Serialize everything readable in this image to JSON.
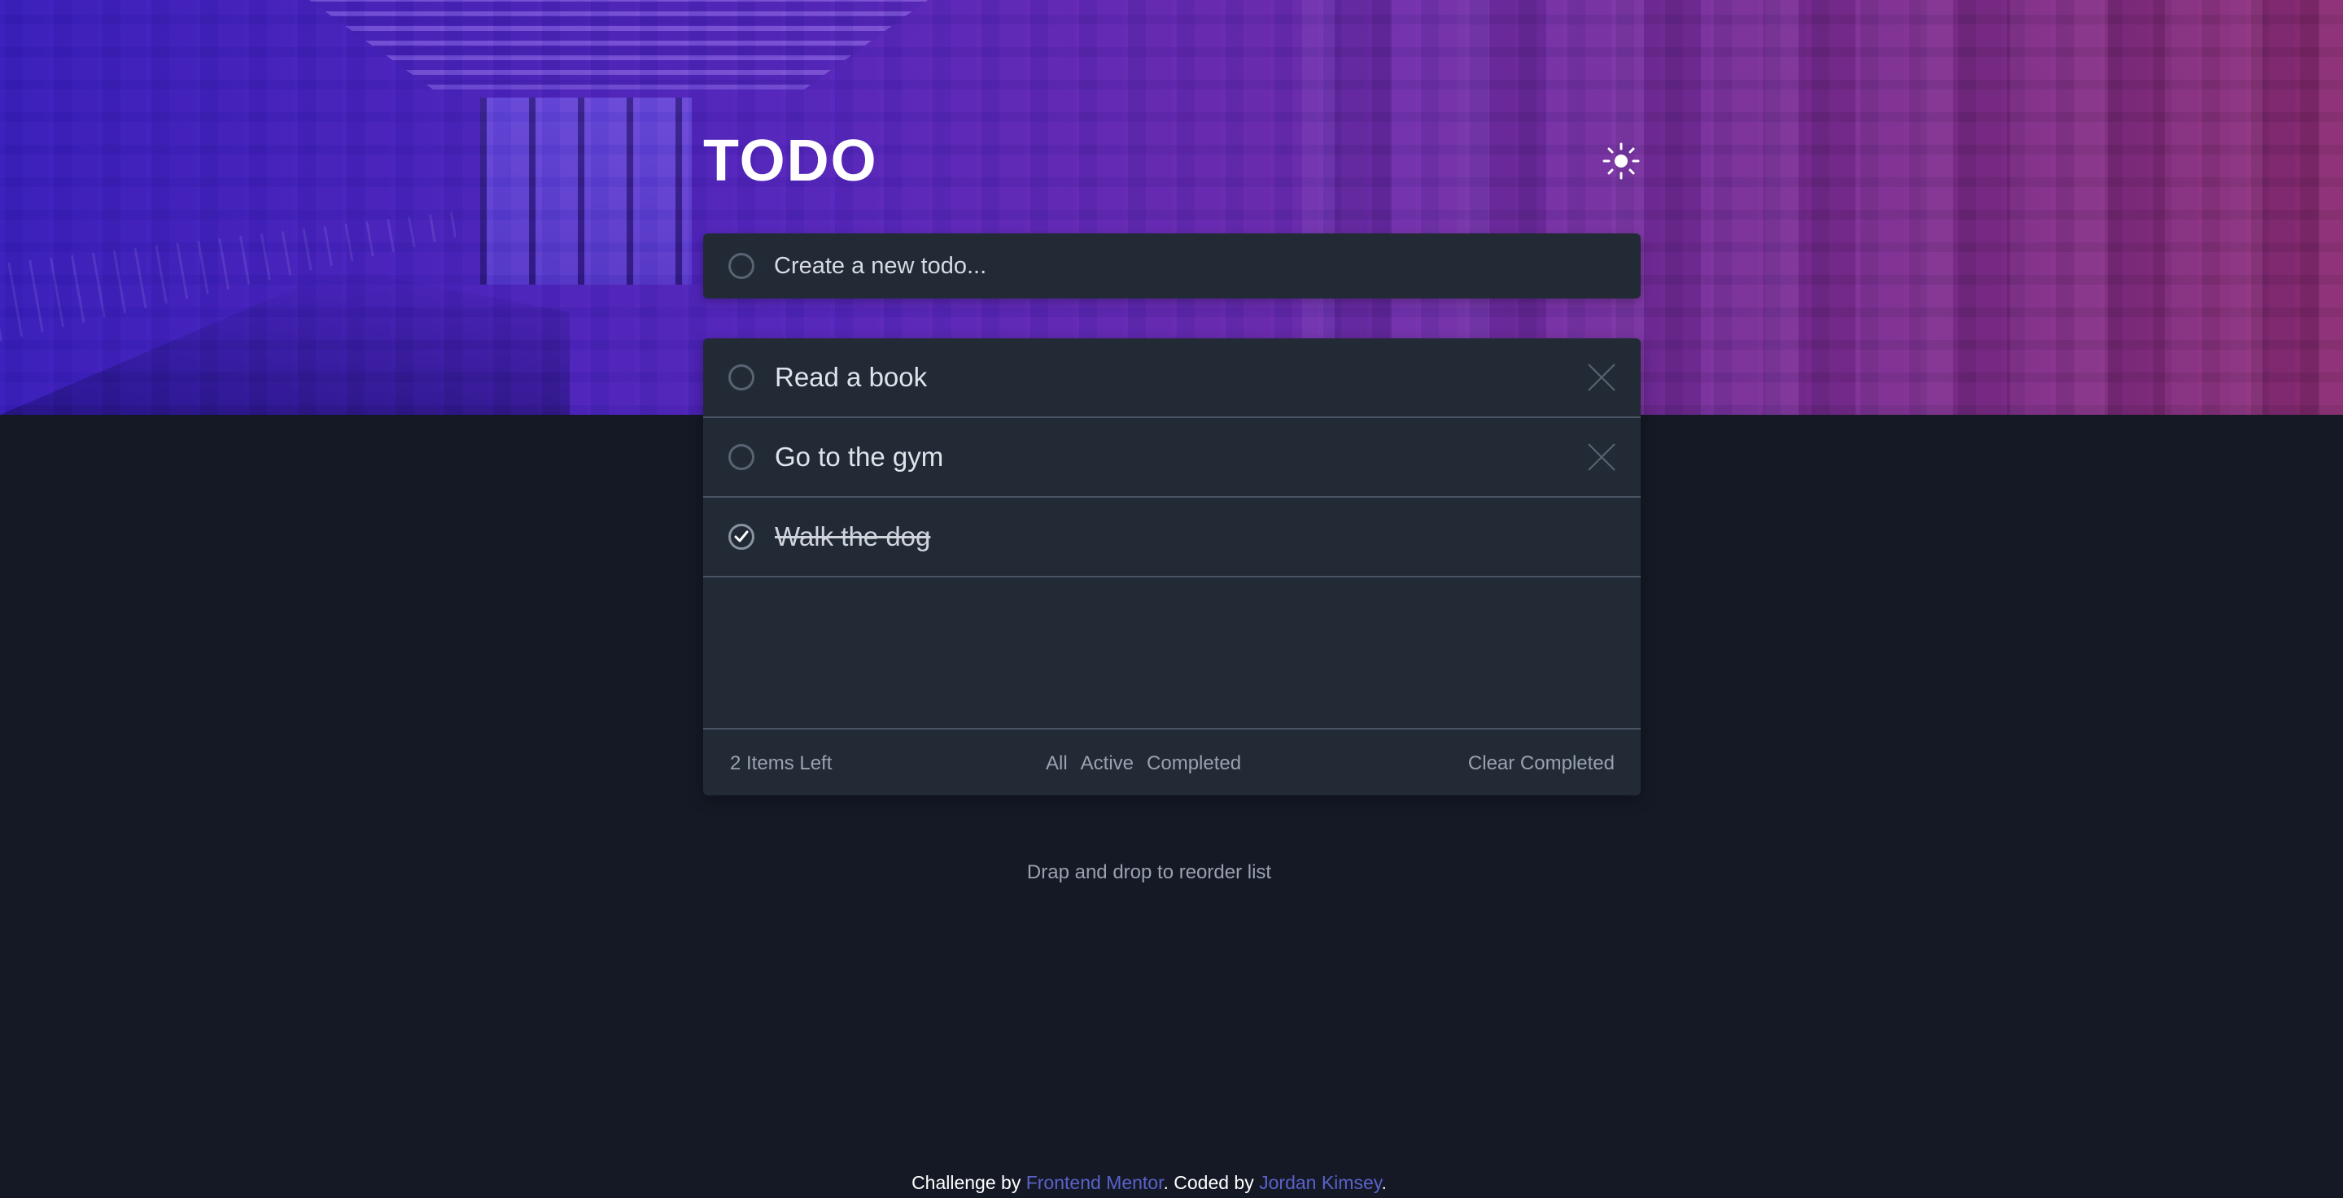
{
  "app": {
    "title": "TODO",
    "theme_icon": "sun-icon"
  },
  "new_todo": {
    "placeholder": "Create a new todo..."
  },
  "todos": [
    {
      "label": "Read a book",
      "completed": false
    },
    {
      "label": "Go to the gym",
      "completed": false
    },
    {
      "label": "Walk the dog",
      "completed": true
    }
  ],
  "footer": {
    "items_left": "2 Items Left",
    "filters": [
      "All",
      "Active",
      "Completed"
    ],
    "clear_label": "Clear Completed"
  },
  "hint": "Drap and drop to reorder list",
  "attribution": {
    "prefix": "Challenge by ",
    "link1": "Frontend Mentor",
    "middle": ". Coded by ",
    "link2": "Jordan Kimsey",
    "suffix": "."
  },
  "colors": {
    "background": "#141925",
    "card": "#222a36",
    "link": "#5a62c9",
    "hero_start": "#3a1fb8",
    "hero_end": "#862a70"
  }
}
